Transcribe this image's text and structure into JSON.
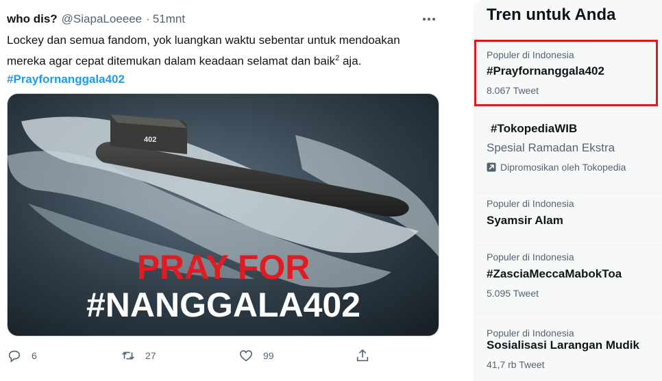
{
  "tweet": {
    "display_name": "who dis?",
    "handle": "@SiapaLoeeee",
    "separator": "·",
    "time": "51mnt",
    "text_line1": "Lockey dan semua fandom, yok luangkan waktu sebentar untuk mendoakan",
    "text_line2_before": "mereka agar cepat ditemukan dalam keadaan selamat dan baik",
    "text_sup": "2",
    "text_line2_after": " aja.",
    "hashtag": "#Prayfornanggala402",
    "image": {
      "hull_number": "402",
      "overlay_line1": "PRAY FOR",
      "overlay_line2": "#NANGGALA402"
    },
    "actions": {
      "replies": "6",
      "retweets": "27",
      "likes": "99"
    }
  },
  "trends": {
    "title": "Tren untuk Anda",
    "items": [
      {
        "context": "Populer di Indonesia",
        "name": "#Prayfornanggala402",
        "count": "8.067 Tweet"
      },
      {
        "name": "#TokopediaWIB",
        "subtitle": "Spesial Ramadan Ekstra",
        "promo": "Dipromosikan oleh Tokopedia"
      },
      {
        "context": "Populer di Indonesia",
        "name": "Syamsir Alam"
      },
      {
        "context": "Populer di Indonesia",
        "name": "#ZasciaMeccaMabokToa",
        "count": "5.095 Tweet"
      },
      {
        "context": "Populer di Indonesia",
        "name": "Sosialisasi Larangan Mudik",
        "count": "41,7 rb Tweet"
      }
    ]
  },
  "colors": {
    "link": "#1d9bf0",
    "muted": "#536471",
    "highlight_border": "#e0161e",
    "overlay_red": "#e11b22"
  }
}
